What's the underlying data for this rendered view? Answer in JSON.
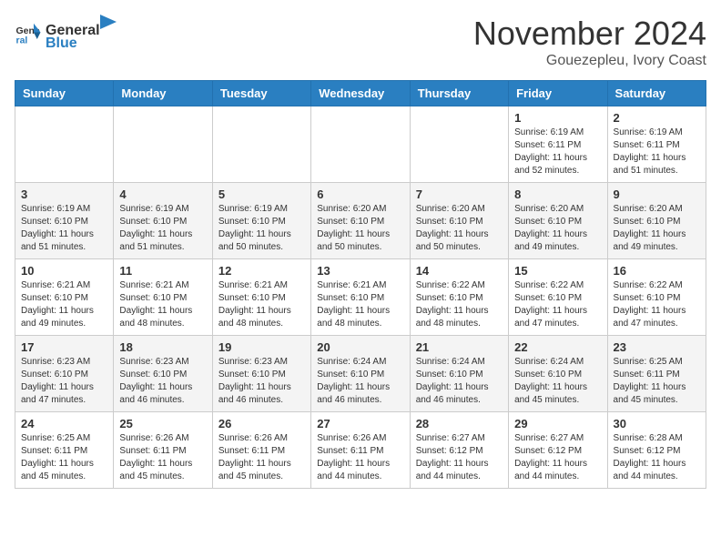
{
  "header": {
    "logo_general": "General",
    "logo_blue": "Blue",
    "month_year": "November 2024",
    "location": "Gouezepleu, Ivory Coast"
  },
  "days_of_week": [
    "Sunday",
    "Monday",
    "Tuesday",
    "Wednesday",
    "Thursday",
    "Friday",
    "Saturday"
  ],
  "weeks": [
    [
      null,
      null,
      null,
      null,
      null,
      {
        "day": 1,
        "sunrise": "6:19 AM",
        "sunset": "6:11 PM",
        "daylight": "11 hours and 52 minutes."
      },
      {
        "day": 2,
        "sunrise": "6:19 AM",
        "sunset": "6:11 PM",
        "daylight": "11 hours and 51 minutes."
      }
    ],
    [
      {
        "day": 3,
        "sunrise": "6:19 AM",
        "sunset": "6:10 PM",
        "daylight": "11 hours and 51 minutes."
      },
      {
        "day": 4,
        "sunrise": "6:19 AM",
        "sunset": "6:10 PM",
        "daylight": "11 hours and 51 minutes."
      },
      {
        "day": 5,
        "sunrise": "6:19 AM",
        "sunset": "6:10 PM",
        "daylight": "11 hours and 50 minutes."
      },
      {
        "day": 6,
        "sunrise": "6:20 AM",
        "sunset": "6:10 PM",
        "daylight": "11 hours and 50 minutes."
      },
      {
        "day": 7,
        "sunrise": "6:20 AM",
        "sunset": "6:10 PM",
        "daylight": "11 hours and 50 minutes."
      },
      {
        "day": 8,
        "sunrise": "6:20 AM",
        "sunset": "6:10 PM",
        "daylight": "11 hours and 49 minutes."
      },
      {
        "day": 9,
        "sunrise": "6:20 AM",
        "sunset": "6:10 PM",
        "daylight": "11 hours and 49 minutes."
      }
    ],
    [
      {
        "day": 10,
        "sunrise": "6:21 AM",
        "sunset": "6:10 PM",
        "daylight": "11 hours and 49 minutes."
      },
      {
        "day": 11,
        "sunrise": "6:21 AM",
        "sunset": "6:10 PM",
        "daylight": "11 hours and 48 minutes."
      },
      {
        "day": 12,
        "sunrise": "6:21 AM",
        "sunset": "6:10 PM",
        "daylight": "11 hours and 48 minutes."
      },
      {
        "day": 13,
        "sunrise": "6:21 AM",
        "sunset": "6:10 PM",
        "daylight": "11 hours and 48 minutes."
      },
      {
        "day": 14,
        "sunrise": "6:22 AM",
        "sunset": "6:10 PM",
        "daylight": "11 hours and 48 minutes."
      },
      {
        "day": 15,
        "sunrise": "6:22 AM",
        "sunset": "6:10 PM",
        "daylight": "11 hours and 47 minutes."
      },
      {
        "day": 16,
        "sunrise": "6:22 AM",
        "sunset": "6:10 PM",
        "daylight": "11 hours and 47 minutes."
      }
    ],
    [
      {
        "day": 17,
        "sunrise": "6:23 AM",
        "sunset": "6:10 PM",
        "daylight": "11 hours and 47 minutes."
      },
      {
        "day": 18,
        "sunrise": "6:23 AM",
        "sunset": "6:10 PM",
        "daylight": "11 hours and 46 minutes."
      },
      {
        "day": 19,
        "sunrise": "6:23 AM",
        "sunset": "6:10 PM",
        "daylight": "11 hours and 46 minutes."
      },
      {
        "day": 20,
        "sunrise": "6:24 AM",
        "sunset": "6:10 PM",
        "daylight": "11 hours and 46 minutes."
      },
      {
        "day": 21,
        "sunrise": "6:24 AM",
        "sunset": "6:10 PM",
        "daylight": "11 hours and 46 minutes."
      },
      {
        "day": 22,
        "sunrise": "6:24 AM",
        "sunset": "6:10 PM",
        "daylight": "11 hours and 45 minutes."
      },
      {
        "day": 23,
        "sunrise": "6:25 AM",
        "sunset": "6:11 PM",
        "daylight": "11 hours and 45 minutes."
      }
    ],
    [
      {
        "day": 24,
        "sunrise": "6:25 AM",
        "sunset": "6:11 PM",
        "daylight": "11 hours and 45 minutes."
      },
      {
        "day": 25,
        "sunrise": "6:26 AM",
        "sunset": "6:11 PM",
        "daylight": "11 hours and 45 minutes."
      },
      {
        "day": 26,
        "sunrise": "6:26 AM",
        "sunset": "6:11 PM",
        "daylight": "11 hours and 45 minutes."
      },
      {
        "day": 27,
        "sunrise": "6:26 AM",
        "sunset": "6:11 PM",
        "daylight": "11 hours and 44 minutes."
      },
      {
        "day": 28,
        "sunrise": "6:27 AM",
        "sunset": "6:12 PM",
        "daylight": "11 hours and 44 minutes."
      },
      {
        "day": 29,
        "sunrise": "6:27 AM",
        "sunset": "6:12 PM",
        "daylight": "11 hours and 44 minutes."
      },
      {
        "day": 30,
        "sunrise": "6:28 AM",
        "sunset": "6:12 PM",
        "daylight": "11 hours and 44 minutes."
      }
    ]
  ]
}
